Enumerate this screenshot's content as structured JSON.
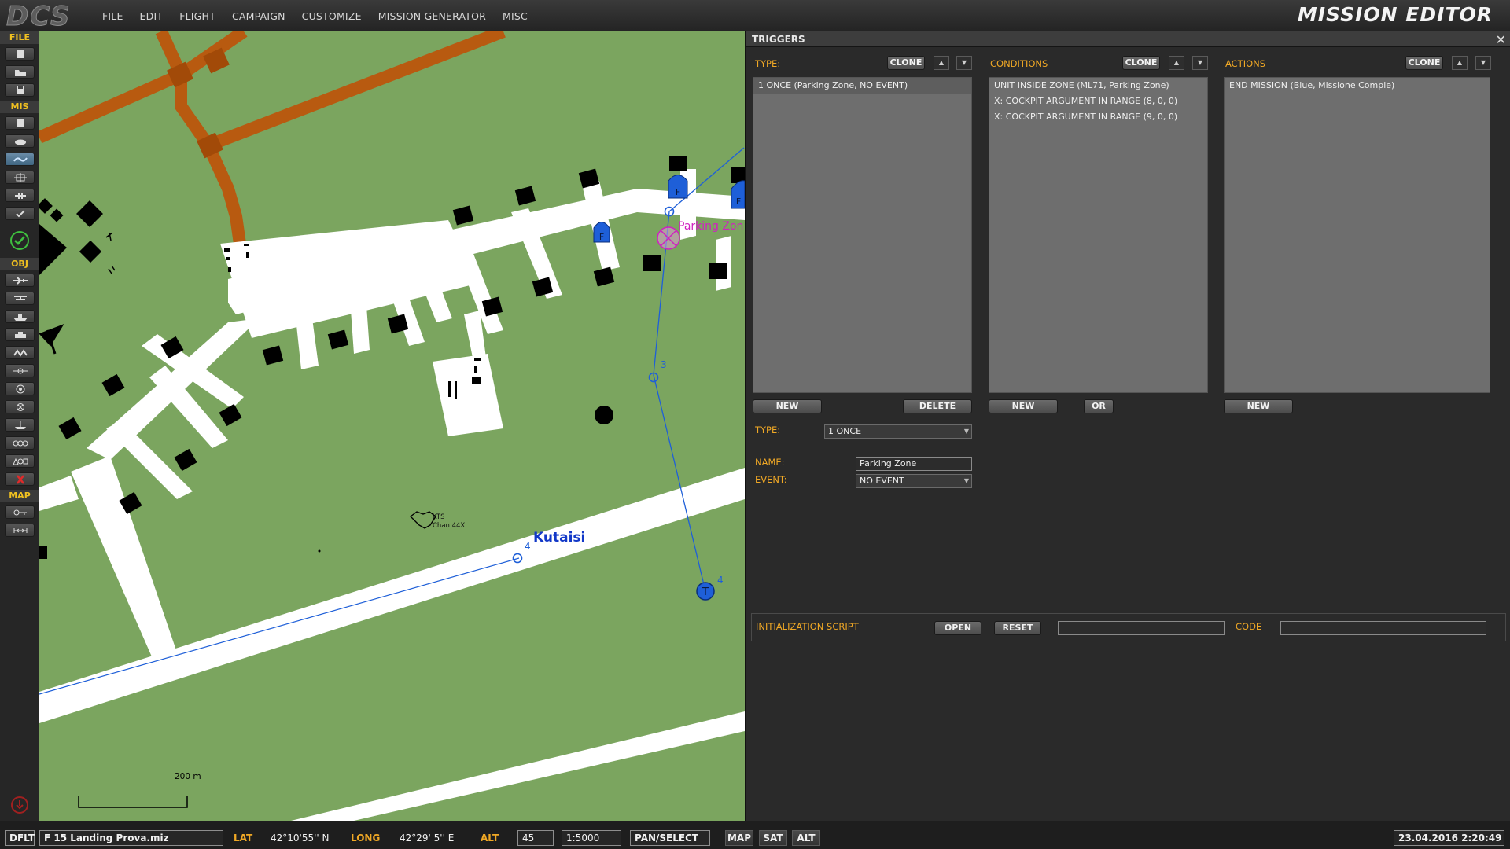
{
  "menubar": {
    "logo": "DCS",
    "items": [
      "FILE",
      "EDIT",
      "FLIGHT",
      "CAMPAIGN",
      "CUSTOMIZE",
      "MISSION GENERATOR",
      "MISC"
    ],
    "title": "MISSION EDITOR"
  },
  "toolbar": {
    "sections": [
      "FILE",
      "MIS",
      "OBJ",
      "MAP"
    ]
  },
  "map": {
    "airfield_name": "Kutaisi",
    "beacon_line1": "KTS",
    "beacon_line2": "Chan 44X",
    "zone_label": "Parking Zon",
    "waypoint_3": "3",
    "waypoint_4a": "4",
    "waypoint_4b": "4",
    "parking_marker": "F",
    "target_marker": "T",
    "scale_label": "200 m"
  },
  "triggers": {
    "title": "TRIGGERS",
    "type_label": "TYPE:",
    "conditions_label": "CONDITIONS",
    "actions_label": "ACTIONS",
    "clone": "CLONE",
    "up": "▲",
    "down": "▼",
    "trigger_list": [
      "1 ONCE (Parking Zone, NO EVENT)"
    ],
    "conditions_list": [
      "UNIT INSIDE ZONE (ML71, Parking Zone)",
      "X: COCKPIT ARGUMENT IN RANGE (8, 0, 0)",
      "X: COCKPIT ARGUMENT IN RANGE (9, 0, 0)"
    ],
    "actions_list": [
      "END MISSION (Blue, Missione Comple)"
    ],
    "new": "NEW",
    "delete": "DELETE",
    "or": "OR",
    "type_value": "1 ONCE",
    "name_label": "NAME:",
    "name_value": "Parking Zone",
    "event_label": "EVENT:",
    "event_value": "NO EVENT",
    "init_script_label": "INITIALIZATION SCRIPT",
    "open": "OPEN",
    "reset": "RESET",
    "code_label": "CODE",
    "script_value": "",
    "code_value": ""
  },
  "statusbar": {
    "mode": "DFLT",
    "filename": "F 15 Landing Prova.miz",
    "lat_label": "LAT",
    "lat_value": "42°10'55'' N",
    "long_label": "LONG",
    "long_value": "42°29' 5'' E",
    "alt_label": "ALT",
    "alt_value": "45",
    "scale": "1:5000",
    "tool": "PAN/SELECT",
    "btn_map": "MAP",
    "btn_sat": "SAT",
    "btn_alt": "ALT",
    "datetime": "23.04.2016 2:20:49"
  },
  "colors": {
    "map_green": "#7ba55f",
    "road": "#b85a10",
    "waypoint_blue": "#1e5fd8",
    "zone_magenta": "#d020c0",
    "accent_orange": "#f0a825"
  }
}
